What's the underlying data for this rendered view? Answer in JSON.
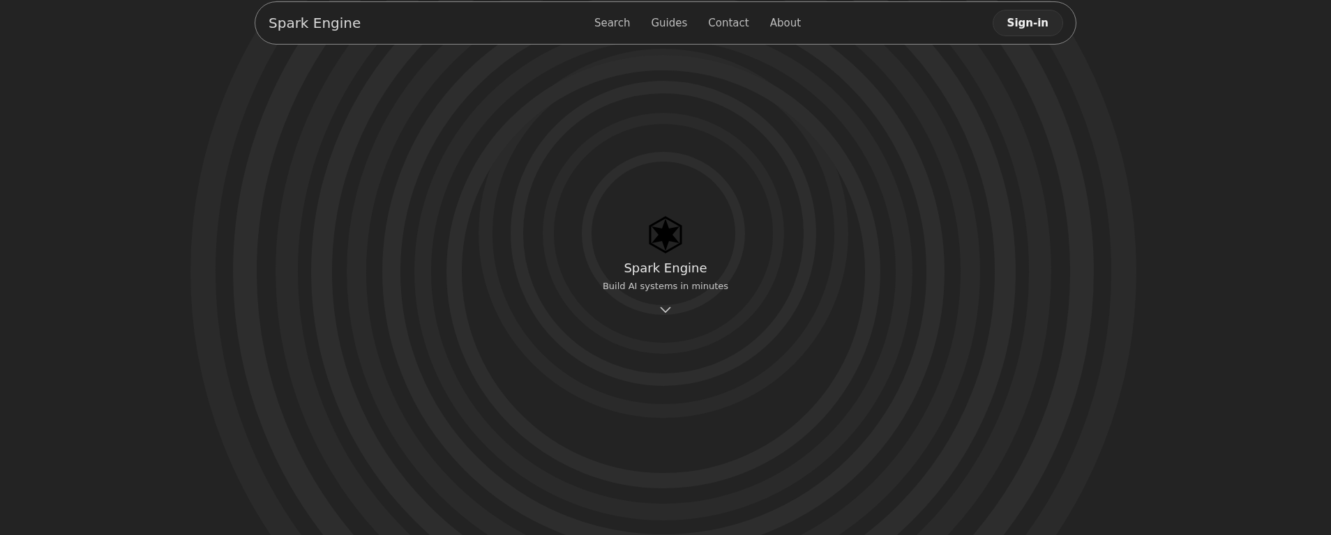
{
  "navbar": {
    "brand": "Spark Engine",
    "links": [
      {
        "label": "Search"
      },
      {
        "label": "Guides"
      },
      {
        "label": "Contact"
      },
      {
        "label": "About"
      }
    ],
    "button": "Sign-in"
  },
  "hero": {
    "title": "Spark Engine",
    "subtitle": "Build AI systems in minutes"
  }
}
